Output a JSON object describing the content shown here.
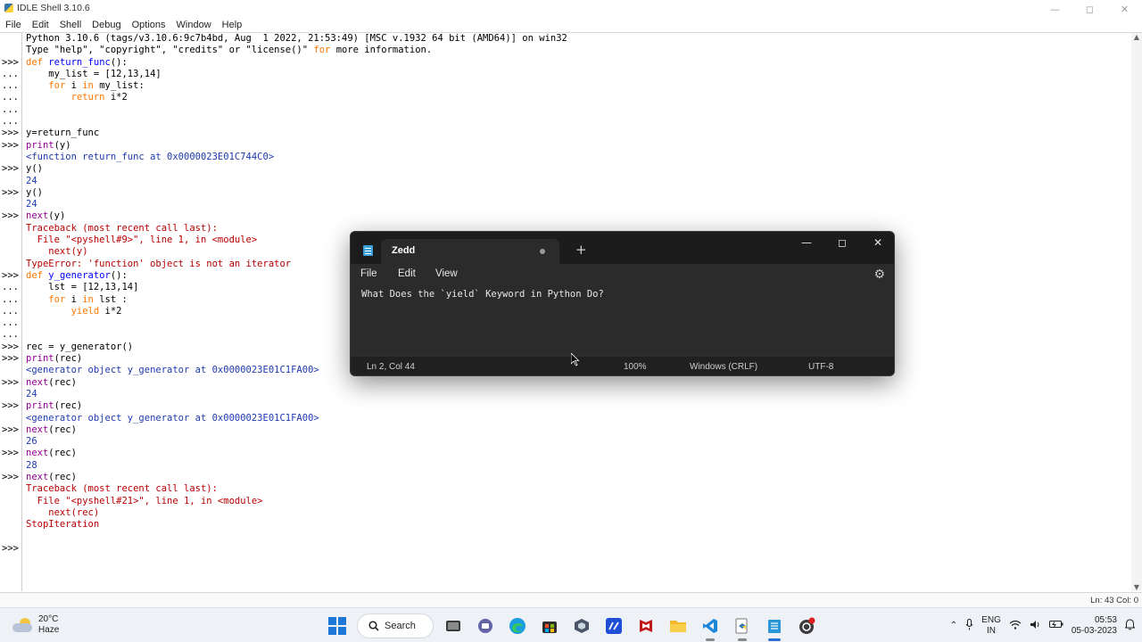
{
  "idle": {
    "title": "IDLE Shell 3.10.6",
    "menu": [
      "File",
      "Edit",
      "Shell",
      "Debug",
      "Options",
      "Window",
      "Help"
    ],
    "lines": [
      {
        "p": "",
        "t": "Python 3.10.6 (tags/v3.10.6:9c7b4bd, Aug  1 2022, 21:53:49) [MSC v.1932 64 bit (AMD64)] on win32",
        "c": "default"
      },
      {
        "p": "",
        "t": "Type \"help\", \"copyright\", \"credits\" or \"license()\" for more information.",
        "c": "default"
      },
      {
        "p": ">>>",
        "t": "def return_func():",
        "c": "default"
      },
      {
        "p": "...",
        "t": "    my_list = [12,13,14]",
        "c": "default"
      },
      {
        "p": "...",
        "t": "    for i in my_list:",
        "c": "default"
      },
      {
        "p": "...",
        "t": "        return i*2",
        "c": "default"
      },
      {
        "p": "...",
        "t": "",
        "c": "default"
      },
      {
        "p": "...",
        "t": "",
        "c": "default"
      },
      {
        "p": ">>>",
        "t": "y=return_func",
        "c": "default"
      },
      {
        "p": ">>>",
        "t": "print(y)",
        "c": "default"
      },
      {
        "p": "",
        "t": "<function return_func at 0x0000023E01C744C0>",
        "c": "out"
      },
      {
        "p": ">>>",
        "t": "y()",
        "c": "default"
      },
      {
        "p": "",
        "t": "24",
        "c": "out"
      },
      {
        "p": ">>>",
        "t": "y()",
        "c": "default"
      },
      {
        "p": "",
        "t": "24",
        "c": "out"
      },
      {
        "p": ">>>",
        "t": "next(y)",
        "c": "default"
      },
      {
        "p": "",
        "t": "Traceback (most recent call last):",
        "c": "err"
      },
      {
        "p": "",
        "t": "  File \"<pyshell#9>\", line 1, in <module>",
        "c": "err"
      },
      {
        "p": "",
        "t": "    next(y)",
        "c": "err"
      },
      {
        "p": "",
        "t": "TypeError: 'function' object is not an iterator",
        "c": "err"
      },
      {
        "p": ">>>",
        "t": "def y_generator():",
        "c": "default"
      },
      {
        "p": "...",
        "t": "    lst = [12,13,14]",
        "c": "default"
      },
      {
        "p": "...",
        "t": "    for i in lst :",
        "c": "default"
      },
      {
        "p": "...",
        "t": "        yield i*2",
        "c": "default"
      },
      {
        "p": "...",
        "t": "",
        "c": "default"
      },
      {
        "p": "...",
        "t": "",
        "c": "default"
      },
      {
        "p": ">>>",
        "t": "rec = y_generator()",
        "c": "default"
      },
      {
        "p": ">>>",
        "t": "print(rec)",
        "c": "default"
      },
      {
        "p": "",
        "t": "<generator object y_generator at 0x0000023E01C1FA00>",
        "c": "out"
      },
      {
        "p": ">>>",
        "t": "next(rec)",
        "c": "default"
      },
      {
        "p": "",
        "t": "24",
        "c": "out"
      },
      {
        "p": ">>>",
        "t": "print(rec)",
        "c": "default"
      },
      {
        "p": "",
        "t": "<generator object y_generator at 0x0000023E01C1FA00>",
        "c": "out"
      },
      {
        "p": ">>>",
        "t": "next(rec)",
        "c": "default"
      },
      {
        "p": "",
        "t": "26",
        "c": "out"
      },
      {
        "p": ">>>",
        "t": "next(rec)",
        "c": "default"
      },
      {
        "p": "",
        "t": "28",
        "c": "out"
      },
      {
        "p": ">>>",
        "t": "next(rec)",
        "c": "default"
      },
      {
        "p": "",
        "t": "Traceback (most recent call last):",
        "c": "err"
      },
      {
        "p": "",
        "t": "  File \"<pyshell#21>\", line 1, in <module>",
        "c": "err"
      },
      {
        "p": "",
        "t": "    next(rec)",
        "c": "err"
      },
      {
        "p": "",
        "t": "StopIteration",
        "c": "err"
      },
      {
        "p": "",
        "t": "",
        "c": "default"
      },
      {
        "p": ">>>",
        "t": "",
        "c": "default"
      }
    ],
    "status": "Ln: 43   Col: 0"
  },
  "notepad": {
    "tab_title": "Zedd",
    "menu": {
      "file": "File",
      "edit": "Edit",
      "view": "View"
    },
    "content": "What Does the `yield` Keyword in Python Do?",
    "status": {
      "position": "Ln 2, Col 44",
      "zoom": "100%",
      "line_ending": "Windows (CRLF)",
      "encoding": "UTF-8"
    }
  },
  "taskbar": {
    "weather_temp": "20°C",
    "weather_desc": "Haze",
    "search_label": "Search",
    "lang_top": "ENG",
    "lang_bottom": "IN",
    "time": "05:53",
    "date": "05-03-2023"
  },
  "colors": {
    "idle_default": "#000000",
    "idle_output": "#1e3ab0",
    "idle_error": "#b80000",
    "idle_keyword": "#ff7700",
    "notepad_bg": "#2b2b2b"
  }
}
